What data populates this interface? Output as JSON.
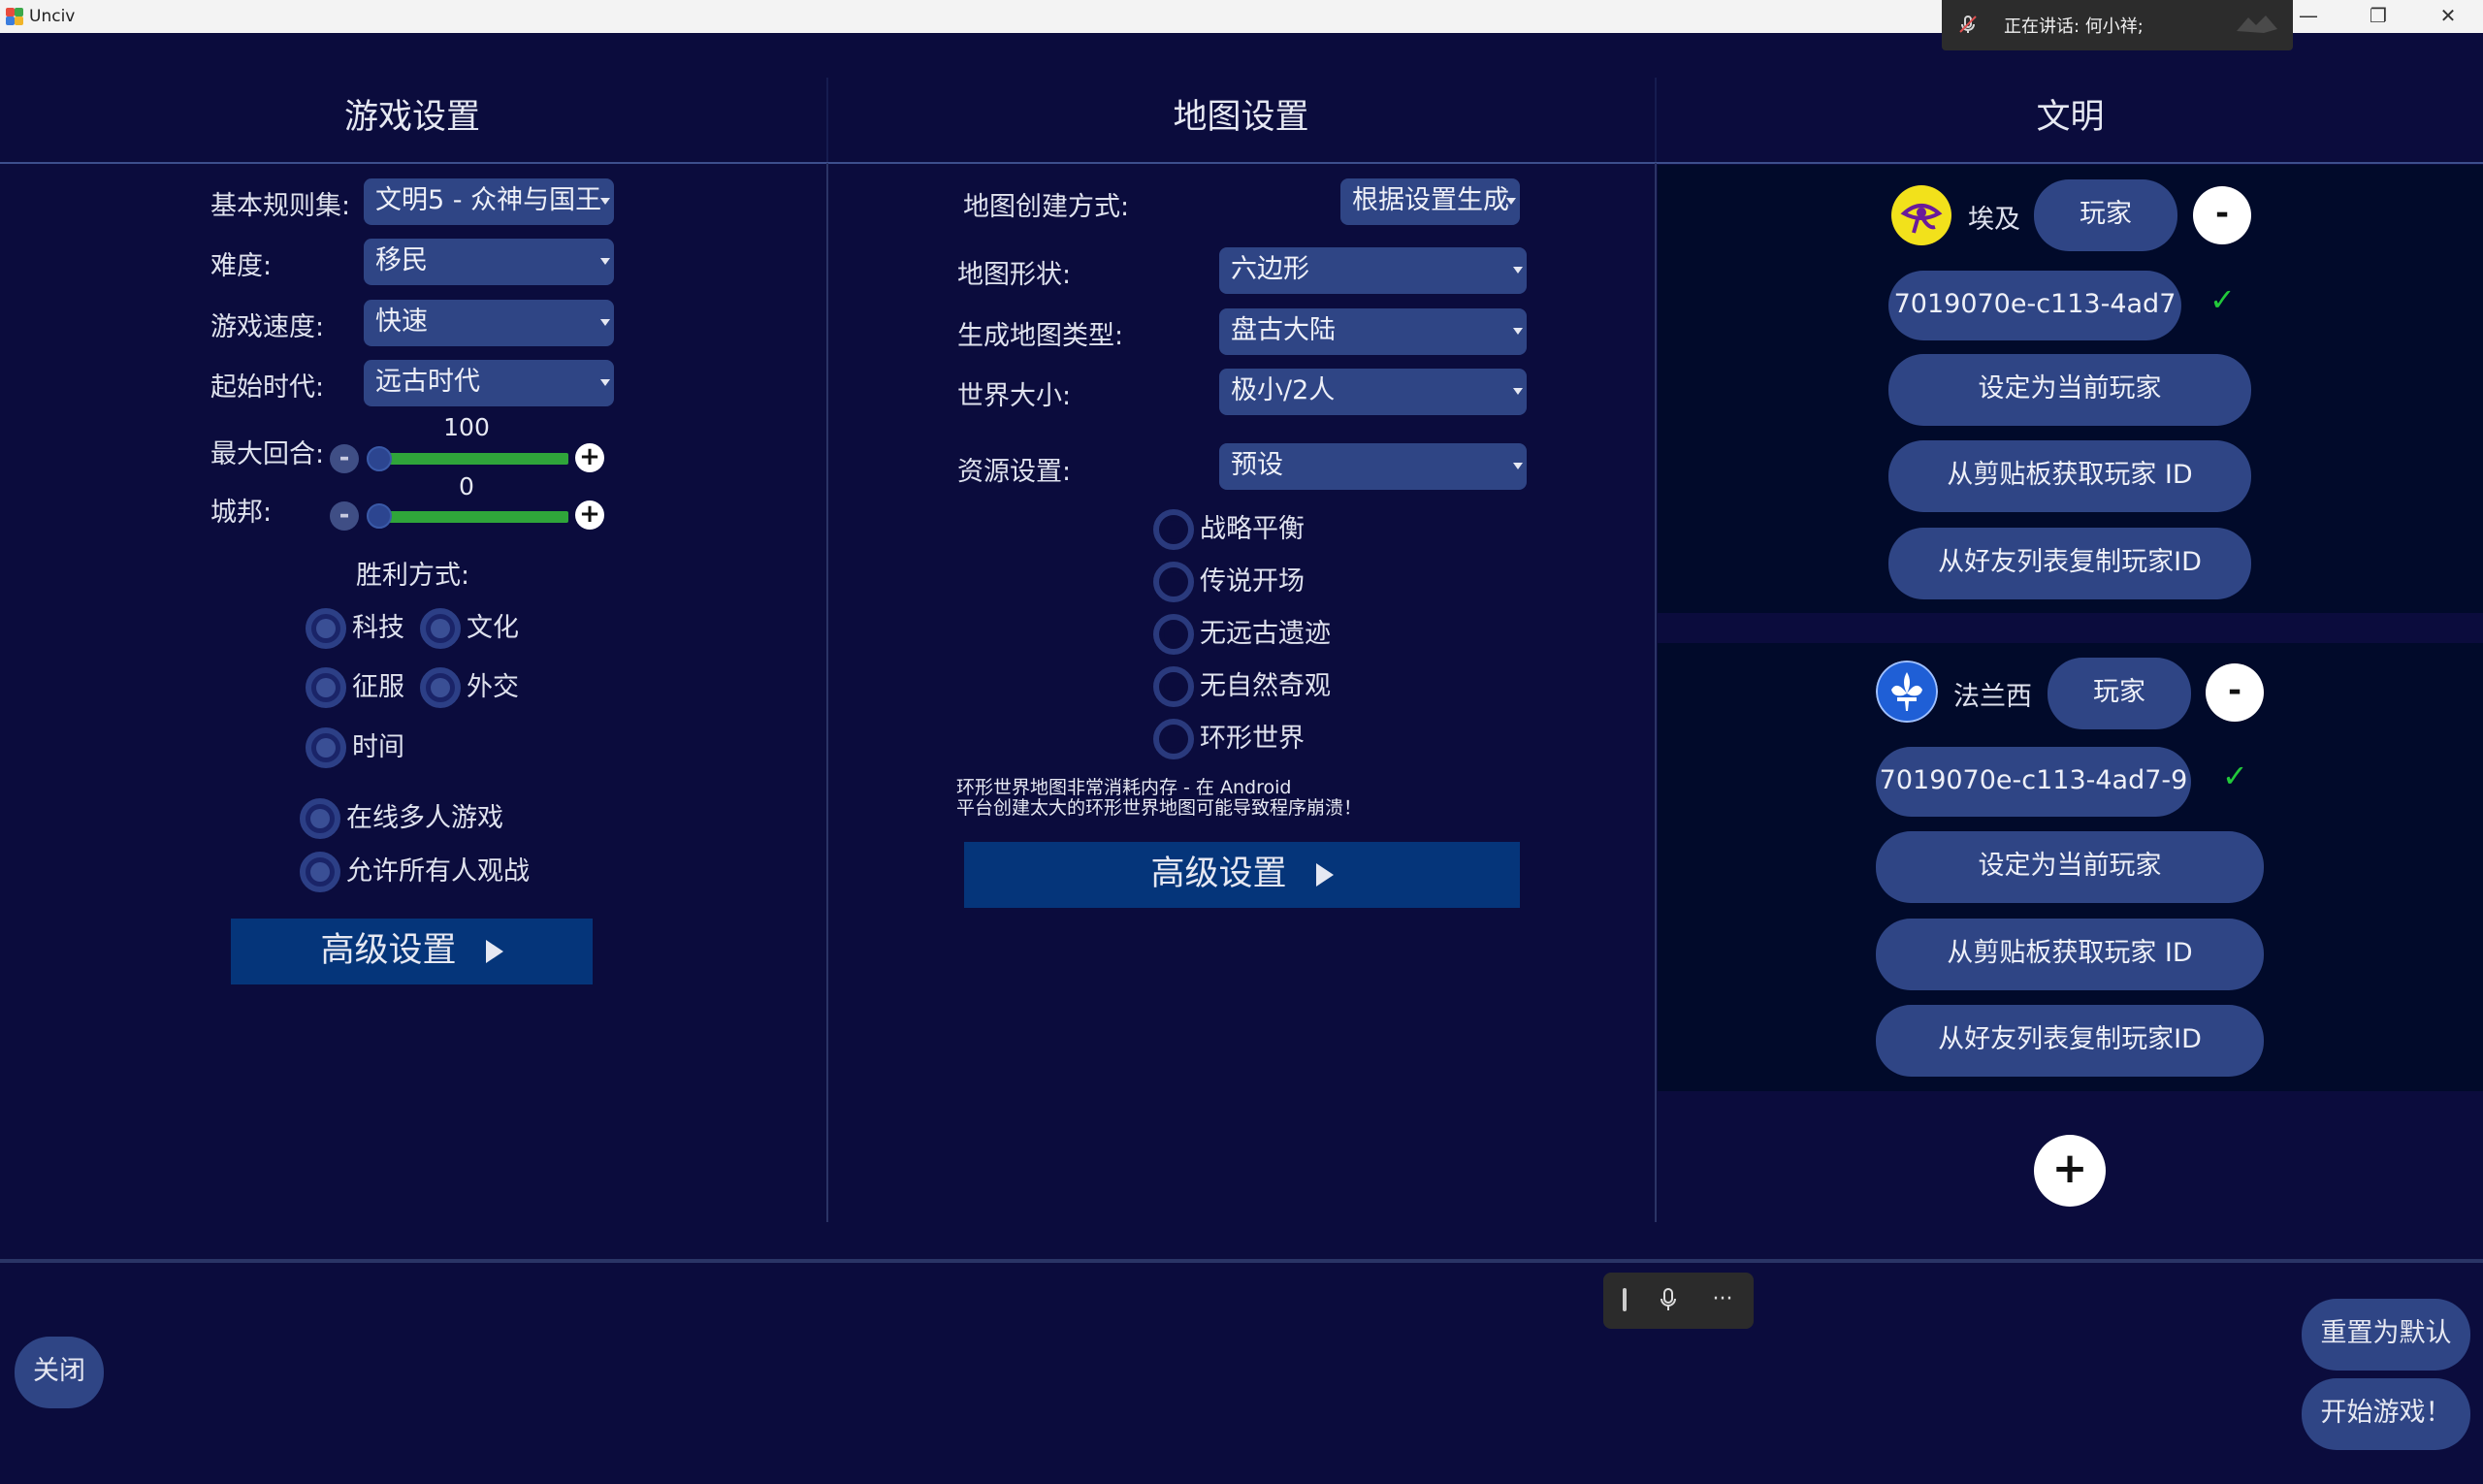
{
  "window": {
    "title": "Unciv",
    "minimize": "—",
    "maximize": "❐",
    "close": "✕"
  },
  "speaking": {
    "text": "正在讲话:  何小祥;"
  },
  "columns": {
    "game": "游戏设置",
    "map": "地图设置",
    "civ": "文明"
  },
  "game": {
    "ruleset_label": "基本规则集:",
    "ruleset_value": "文明5 - 众神与国王",
    "difficulty_label": "难度:",
    "difficulty_value": "移民",
    "speed_label": "游戏速度:",
    "speed_value": "快速",
    "era_label": "起始时代:",
    "era_value": "远古时代",
    "max_turns_label": "最大回合:",
    "max_turns_value": "100",
    "city_states_label": "城邦:",
    "city_states_value": "0",
    "victory_label": "胜利方式:",
    "victory": {
      "science": "科技",
      "culture": "文化",
      "domination": "征服",
      "diplomatic": "外交",
      "time": "时间"
    },
    "online_multiplayer": "在线多人游戏",
    "allow_spectators": "允许所有人观战",
    "advanced": "高级设置"
  },
  "map": {
    "creation_label": "地图创建方式:",
    "creation_value": "根据设置生成",
    "shape_label": "地图形状:",
    "shape_value": "六边形",
    "type_label": "生成地图类型:",
    "type_value": "盘古大陆",
    "size_label": "世界大小:",
    "size_value": "极小/2人",
    "resource_label": "资源设置:",
    "resource_value": "预设",
    "options": {
      "strategic_balance": "战略平衡",
      "legendary_start": "传说开场",
      "no_ruins": "无远古遗迹",
      "no_wonders": "无自然奇观",
      "world_wrap": "环形世界"
    },
    "warning_line1": "环形世界地图非常消耗内存 - 在 Android",
    "warning_line2": "平台创建太大的环形世界地图可能导致程序崩溃！",
    "advanced": "高级设置"
  },
  "civs": [
    {
      "name": "埃及",
      "type": "玩家",
      "remove": "-",
      "id": "7019070e-c113-4ad7",
      "check": "✓",
      "set_current": "设定为当前玩家",
      "from_clipboard": "从剪贴板获取玩家 ID",
      "from_friends": "从好友列表复制玩家ID",
      "icon_bg": "#f2e11b",
      "icon_fg": "#6a1b9a"
    },
    {
      "name": "法兰西",
      "type": "玩家",
      "remove": "-",
      "id": "7019070e-c113-4ad7-9",
      "check": "✓",
      "set_current": "设定为当前玩家",
      "from_clipboard": "从剪贴板获取玩家 ID",
      "from_friends": "从好友列表复制玩家ID",
      "icon_bg": "#1f5fd6",
      "icon_fg": "#ffffff"
    }
  ],
  "add_player": "+",
  "bottom": {
    "close": "关闭",
    "reset": "重置为默认",
    "start": "开始游戏！"
  },
  "float_bar": {
    "more": "···"
  }
}
